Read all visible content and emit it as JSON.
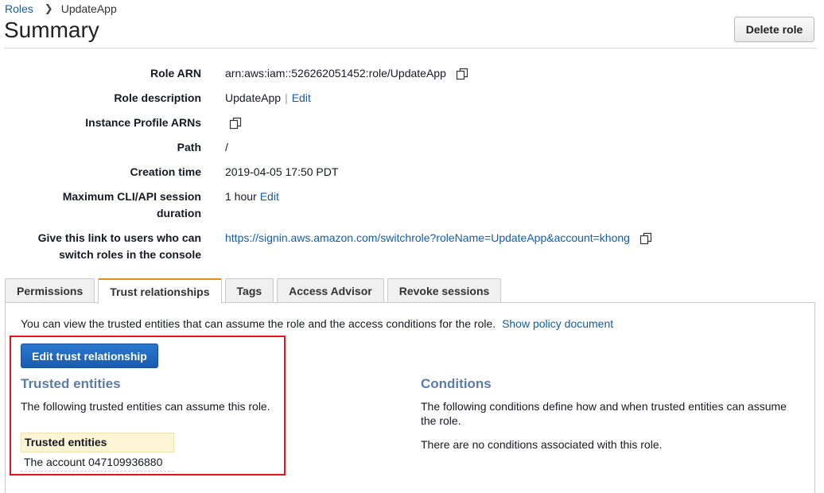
{
  "breadcrumb": {
    "parent": "Roles",
    "current": "UpdateApp"
  },
  "page": {
    "title": "Summary",
    "delete_label": "Delete role"
  },
  "summary": {
    "role_arn": {
      "label": "Role ARN",
      "value": "arn:aws:iam::526262051452:role/UpdateApp"
    },
    "role_description": {
      "label": "Role description",
      "value": "UpdateApp",
      "edit": "Edit"
    },
    "instance_profile": {
      "label": "Instance Profile ARNs"
    },
    "path": {
      "label": "Path",
      "value": "/"
    },
    "creation_time": {
      "label": "Creation time",
      "value": "2019-04-05 17:50 PDT"
    },
    "session_duration": {
      "label_line1": "Maximum CLI/API session",
      "label_line2": "duration",
      "value": "1 hour",
      "edit": "Edit"
    },
    "switch_link": {
      "label_line1": "Give this link to users who can",
      "label_line2": "switch roles in the console",
      "value": "https://signin.aws.amazon.com/switchrole?roleName=UpdateApp&account=khong"
    }
  },
  "tabs": [
    {
      "label": "Permissions",
      "active": false
    },
    {
      "label": "Trust relationships",
      "active": true
    },
    {
      "label": "Tags",
      "active": false
    },
    {
      "label": "Access Advisor",
      "active": false
    },
    {
      "label": "Revoke sessions",
      "active": false
    }
  ],
  "trust": {
    "description": "You can view the trusted entities that can assume the role and the access conditions for the role.",
    "show_policy": "Show policy document",
    "edit_button": "Edit trust relationship",
    "entities_title": "Trusted entities",
    "entities_text": "The following trusted entities can assume this role.",
    "table_header": "Trusted entities",
    "table_rows": [
      "The account 047109936880"
    ],
    "conditions_title": "Conditions",
    "conditions_line1": "The following conditions define how and when trusted entities can assume",
    "conditions_line2": "the role.",
    "no_conditions": "There are no conditions associated with this role."
  },
  "colors": {
    "link": "#0f5ea8",
    "primary_button": "#1a5cae",
    "active_tab_accent": "#e28f1b",
    "highlight": "#e0161c",
    "section_title": "#5a7da8"
  }
}
